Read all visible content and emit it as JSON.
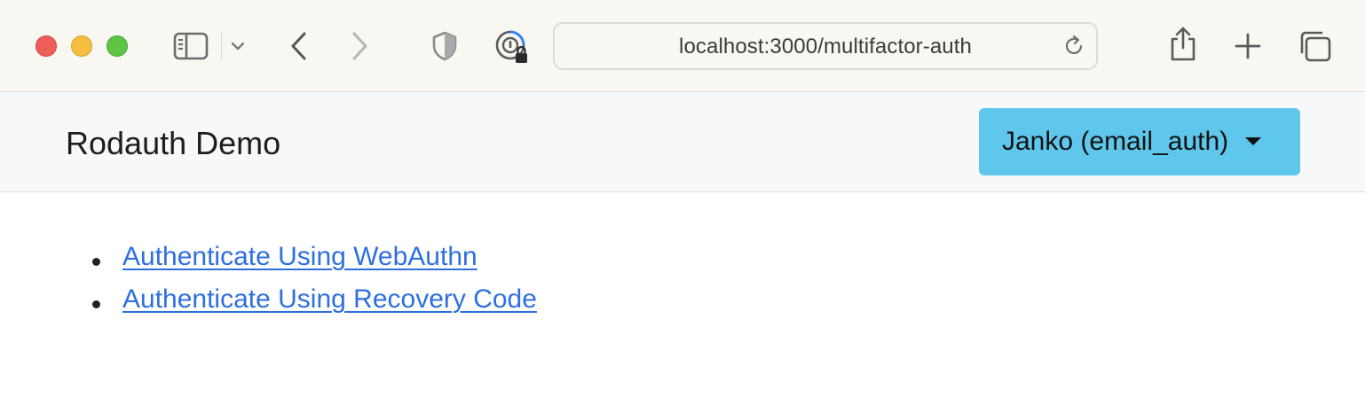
{
  "browser": {
    "url": "localhost:3000/multifactor-auth",
    "icons": {
      "sidebar": "sidebar-icon",
      "sidebar_menu": "chevron-down-icon",
      "back": "back-arrow-icon",
      "forward": "forward-arrow-icon",
      "privacy": "shield-icon",
      "password": "password-key-icon",
      "reload": "reload-icon",
      "share": "share-icon",
      "new_tab": "plus-icon",
      "tabs": "tab-overview-icon"
    },
    "colors": {
      "close": "#ee5e58",
      "minimize": "#f5be3f",
      "maximize": "#5ec443"
    }
  },
  "navbar": {
    "brand": "Rodauth Demo",
    "user_button_label": "Janko (email_auth)",
    "user_button_color": "#5ec7eb"
  },
  "main": {
    "links": [
      {
        "label": "Authenticate Using WebAuthn"
      },
      {
        "label": "Authenticate Using Recovery Code"
      }
    ],
    "link_color": "#2e6fe0"
  }
}
